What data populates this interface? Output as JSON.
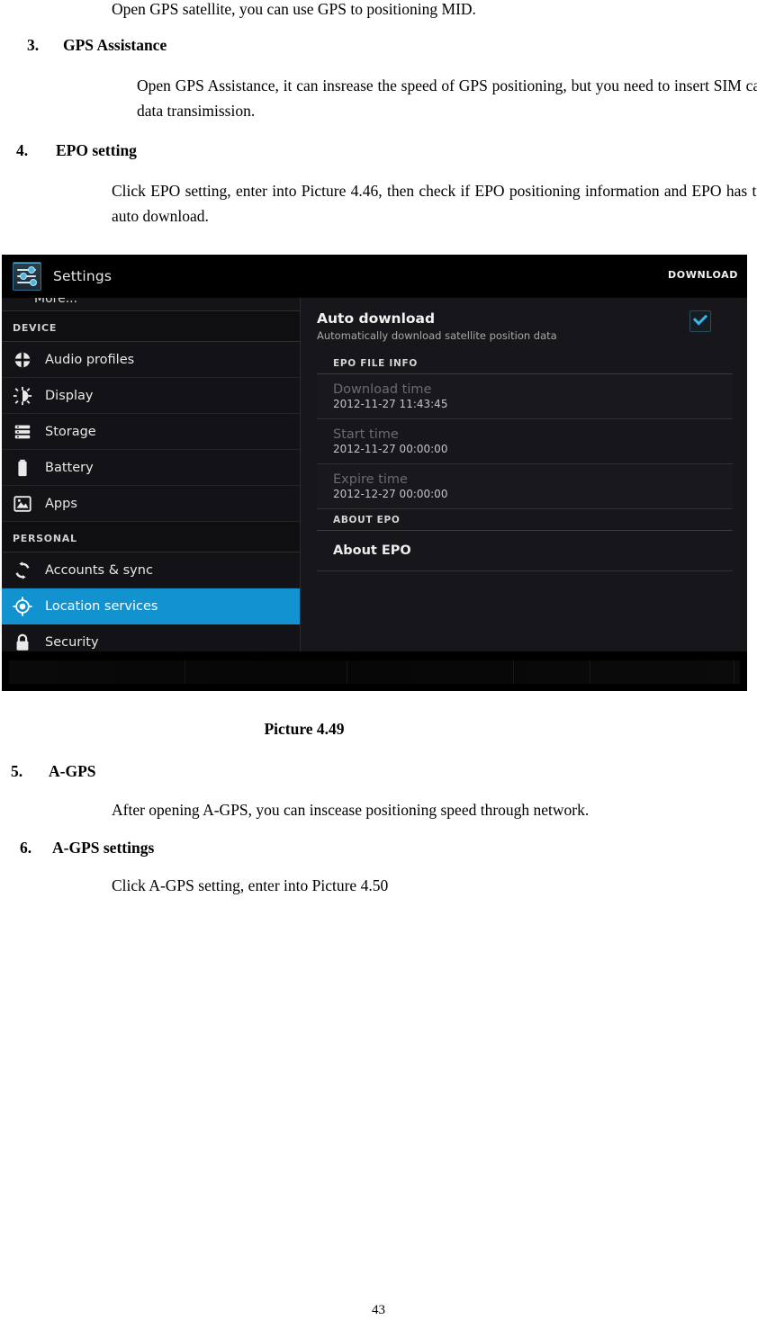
{
  "document": {
    "intro_line": "Open GPS satellite, you can use GPS to positioning MID.",
    "sections": [
      {
        "number": "3.",
        "heading": "GPS Assistance",
        "body": "Open GPS Assistance, it can insrease the speed of GPS positioning, but you need to insert SIM card and use data transimission."
      },
      {
        "number": "4.",
        "heading": "EPO setting",
        "body": "Click EPO setting, enter into Picture 4.46, then check if EPO positioning information and EPO has turned on auto download."
      },
      {
        "number": "5.",
        "heading": "A-GPS",
        "body": "After opening A-GPS, you can inscease positioning speed through network."
      },
      {
        "number": "6.",
        "heading": "A-GPS settings",
        "body": "Click A-GPS setting, enter into Picture 4.50"
      }
    ],
    "figure_caption": "Picture 4.49",
    "page_number": "43"
  },
  "screenshot": {
    "actionbar": {
      "app_icon": "settings-icon",
      "title": "Settings",
      "action_label": "DOWNLOAD"
    },
    "sidebar": {
      "cut_top_label": "More...",
      "sections": [
        {
          "header": "DEVICE",
          "items": [
            {
              "label": "Audio profiles",
              "icon": "audio-profiles-icon",
              "selected": false
            },
            {
              "label": "Display",
              "icon": "display-icon",
              "selected": false
            },
            {
              "label": "Storage",
              "icon": "storage-icon",
              "selected": false
            },
            {
              "label": "Battery",
              "icon": "battery-icon",
              "selected": false
            },
            {
              "label": "Apps",
              "icon": "apps-icon",
              "selected": false
            }
          ]
        },
        {
          "header": "PERSONAL",
          "items": [
            {
              "label": "Accounts & sync",
              "icon": "sync-icon",
              "selected": false
            },
            {
              "label": "Location services",
              "icon": "location-icon",
              "selected": true
            },
            {
              "label": "Security",
              "icon": "lock-icon",
              "selected": false
            }
          ]
        }
      ]
    },
    "detail": {
      "auto_download": {
        "title": "Auto download",
        "subtitle": "Automatically download satellite position data",
        "checked": true
      },
      "epo_file_info_header": "EPO FILE INFO",
      "epo_file_info": [
        {
          "label": "Download time",
          "value": "2012-11-27 11:43:45"
        },
        {
          "label": "Start time",
          "value": "2012-11-27 00:00:00"
        },
        {
          "label": "Expire time",
          "value": "2012-12-27 00:00:00"
        }
      ],
      "about_epo_header": "ABOUT EPO",
      "about_epo_label": "About EPO"
    },
    "accent_color": "#1292cf",
    "checkbox_color": "#33b5e5"
  }
}
